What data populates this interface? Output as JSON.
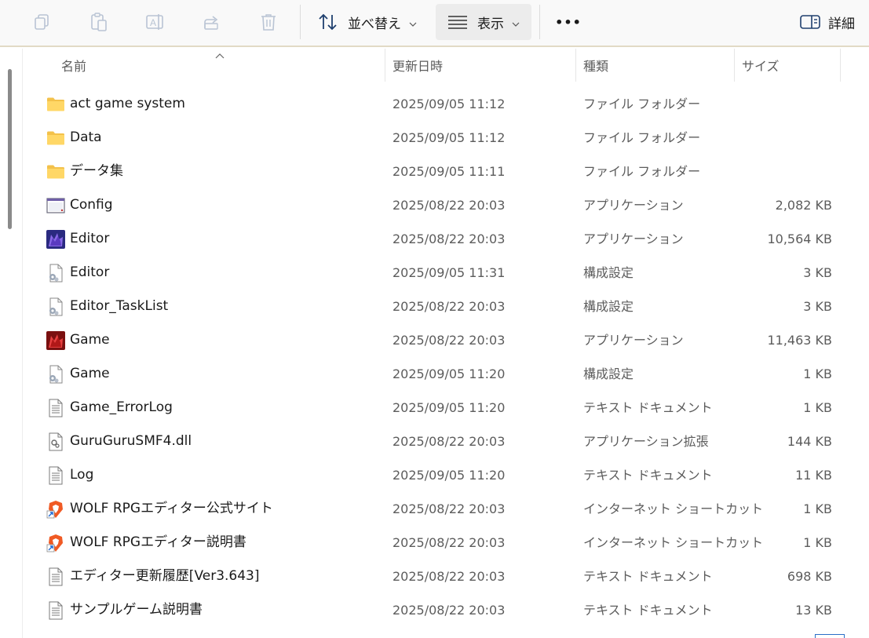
{
  "toolbar": {
    "sort_label": "並べ替え",
    "view_label": "表示",
    "more_label": "•••",
    "details_label": "詳細"
  },
  "columns": {
    "name": "名前",
    "date": "更新日時",
    "type": "種類",
    "size": "サイズ"
  },
  "files": [
    {
      "name": "act game system",
      "date": "2025/09/05 11:12",
      "type": "ファイル フォルダー",
      "size": "",
      "icon": "folder-icon"
    },
    {
      "name": "Data",
      "date": "2025/09/05 11:12",
      "type": "ファイル フォルダー",
      "size": "",
      "icon": "folder-icon"
    },
    {
      "name": "データ集",
      "date": "2025/09/05 11:11",
      "type": "ファイル フォルダー",
      "size": "",
      "icon": "folder-icon"
    },
    {
      "name": "Config",
      "date": "2025/08/22 20:03",
      "type": "アプリケーション",
      "size": "2,082 KB",
      "icon": "window-app-icon"
    },
    {
      "name": "Editor",
      "date": "2025/08/22 20:03",
      "type": "アプリケーション",
      "size": "10,564 KB",
      "icon": "editor-wolf-icon"
    },
    {
      "name": "Editor",
      "date": "2025/09/05 11:31",
      "type": "構成設定",
      "size": "3 KB",
      "icon": "config-file-icon"
    },
    {
      "name": "Editor_TaskList",
      "date": "2025/08/22 20:03",
      "type": "構成設定",
      "size": "3 KB",
      "icon": "config-file-icon"
    },
    {
      "name": "Game",
      "date": "2025/08/22 20:03",
      "type": "アプリケーション",
      "size": "11,463 KB",
      "icon": "game-wolf-icon"
    },
    {
      "name": "Game",
      "date": "2025/09/05 11:20",
      "type": "構成設定",
      "size": "1 KB",
      "icon": "config-file-icon"
    },
    {
      "name": "Game_ErrorLog",
      "date": "2025/09/05 11:20",
      "type": "テキスト ドキュメント",
      "size": "1 KB",
      "icon": "text-file-icon"
    },
    {
      "name": "GuruGuruSMF4.dll",
      "date": "2025/08/22 20:03",
      "type": "アプリケーション拡張",
      "size": "144 KB",
      "icon": "dll-file-icon"
    },
    {
      "name": "Log",
      "date": "2025/09/05 11:20",
      "type": "テキスト ドキュメント",
      "size": "11 KB",
      "icon": "text-file-icon"
    },
    {
      "name": "WOLF RPGエディター公式サイト",
      "date": "2025/08/22 20:03",
      "type": "インターネット ショートカット",
      "size": "1 KB",
      "icon": "brave-shortcut-icon"
    },
    {
      "name": "WOLF RPGエディター説明書",
      "date": "2025/08/22 20:03",
      "type": "インターネット ショートカット",
      "size": "1 KB",
      "icon": "brave-shortcut-icon"
    },
    {
      "name": "エディター更新履歴[Ver3.643]",
      "date": "2025/08/22 20:03",
      "type": "テキスト ドキュメント",
      "size": "698 KB",
      "icon": "text-file-icon"
    },
    {
      "name": "サンプルゲーム説明書",
      "date": "2025/08/22 20:03",
      "type": "テキスト ドキュメント",
      "size": "13 KB",
      "icon": "text-file-icon"
    }
  ]
}
